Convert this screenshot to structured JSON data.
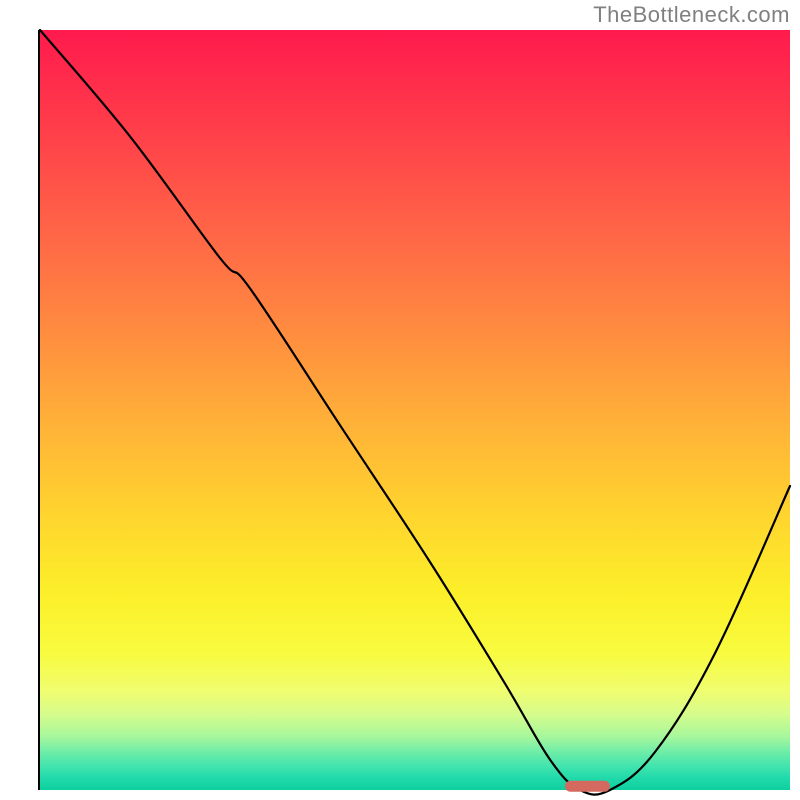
{
  "watermark": "TheBottleneck.com",
  "colors": {
    "curve": "#000000",
    "marker": "#d46a5f",
    "axis": "#000000",
    "watermark": "#808080"
  },
  "chart_data": {
    "type": "line",
    "title": "",
    "xlabel": "",
    "ylabel": "",
    "xlim": [
      0,
      100
    ],
    "ylim": [
      0,
      100
    ],
    "grid": false,
    "series": [
      {
        "name": "bottleneck-curve",
        "x": [
          0,
          12,
          24,
          28,
          40,
          52,
          62,
          68,
          72,
          76,
          82,
          90,
          100
        ],
        "values": [
          100,
          86,
          70,
          66,
          48,
          30,
          14,
          4,
          0,
          0,
          5,
          18,
          40
        ]
      }
    ],
    "marker": {
      "x_start": 70,
      "x_end": 76,
      "y": 0.5
    },
    "background_gradient_stops": [
      {
        "pos": 0,
        "color": "#ff1a4d"
      },
      {
        "pos": 12,
        "color": "#ff3b4a"
      },
      {
        "pos": 28,
        "color": "#ff6946"
      },
      {
        "pos": 40,
        "color": "#ff8d3f"
      },
      {
        "pos": 52,
        "color": "#ffb238"
      },
      {
        "pos": 64,
        "color": "#ffd52e"
      },
      {
        "pos": 74,
        "color": "#fcef29"
      },
      {
        "pos": 82,
        "color": "#f8fb3f"
      },
      {
        "pos": 87,
        "color": "#f0fd6f"
      },
      {
        "pos": 90,
        "color": "#d6fc8c"
      },
      {
        "pos": 93,
        "color": "#a6f79c"
      },
      {
        "pos": 95,
        "color": "#6eeda8"
      },
      {
        "pos": 97,
        "color": "#3fe3ae"
      },
      {
        "pos": 98.5,
        "color": "#1fd9aa"
      },
      {
        "pos": 100,
        "color": "#0fcf9f"
      }
    ]
  }
}
